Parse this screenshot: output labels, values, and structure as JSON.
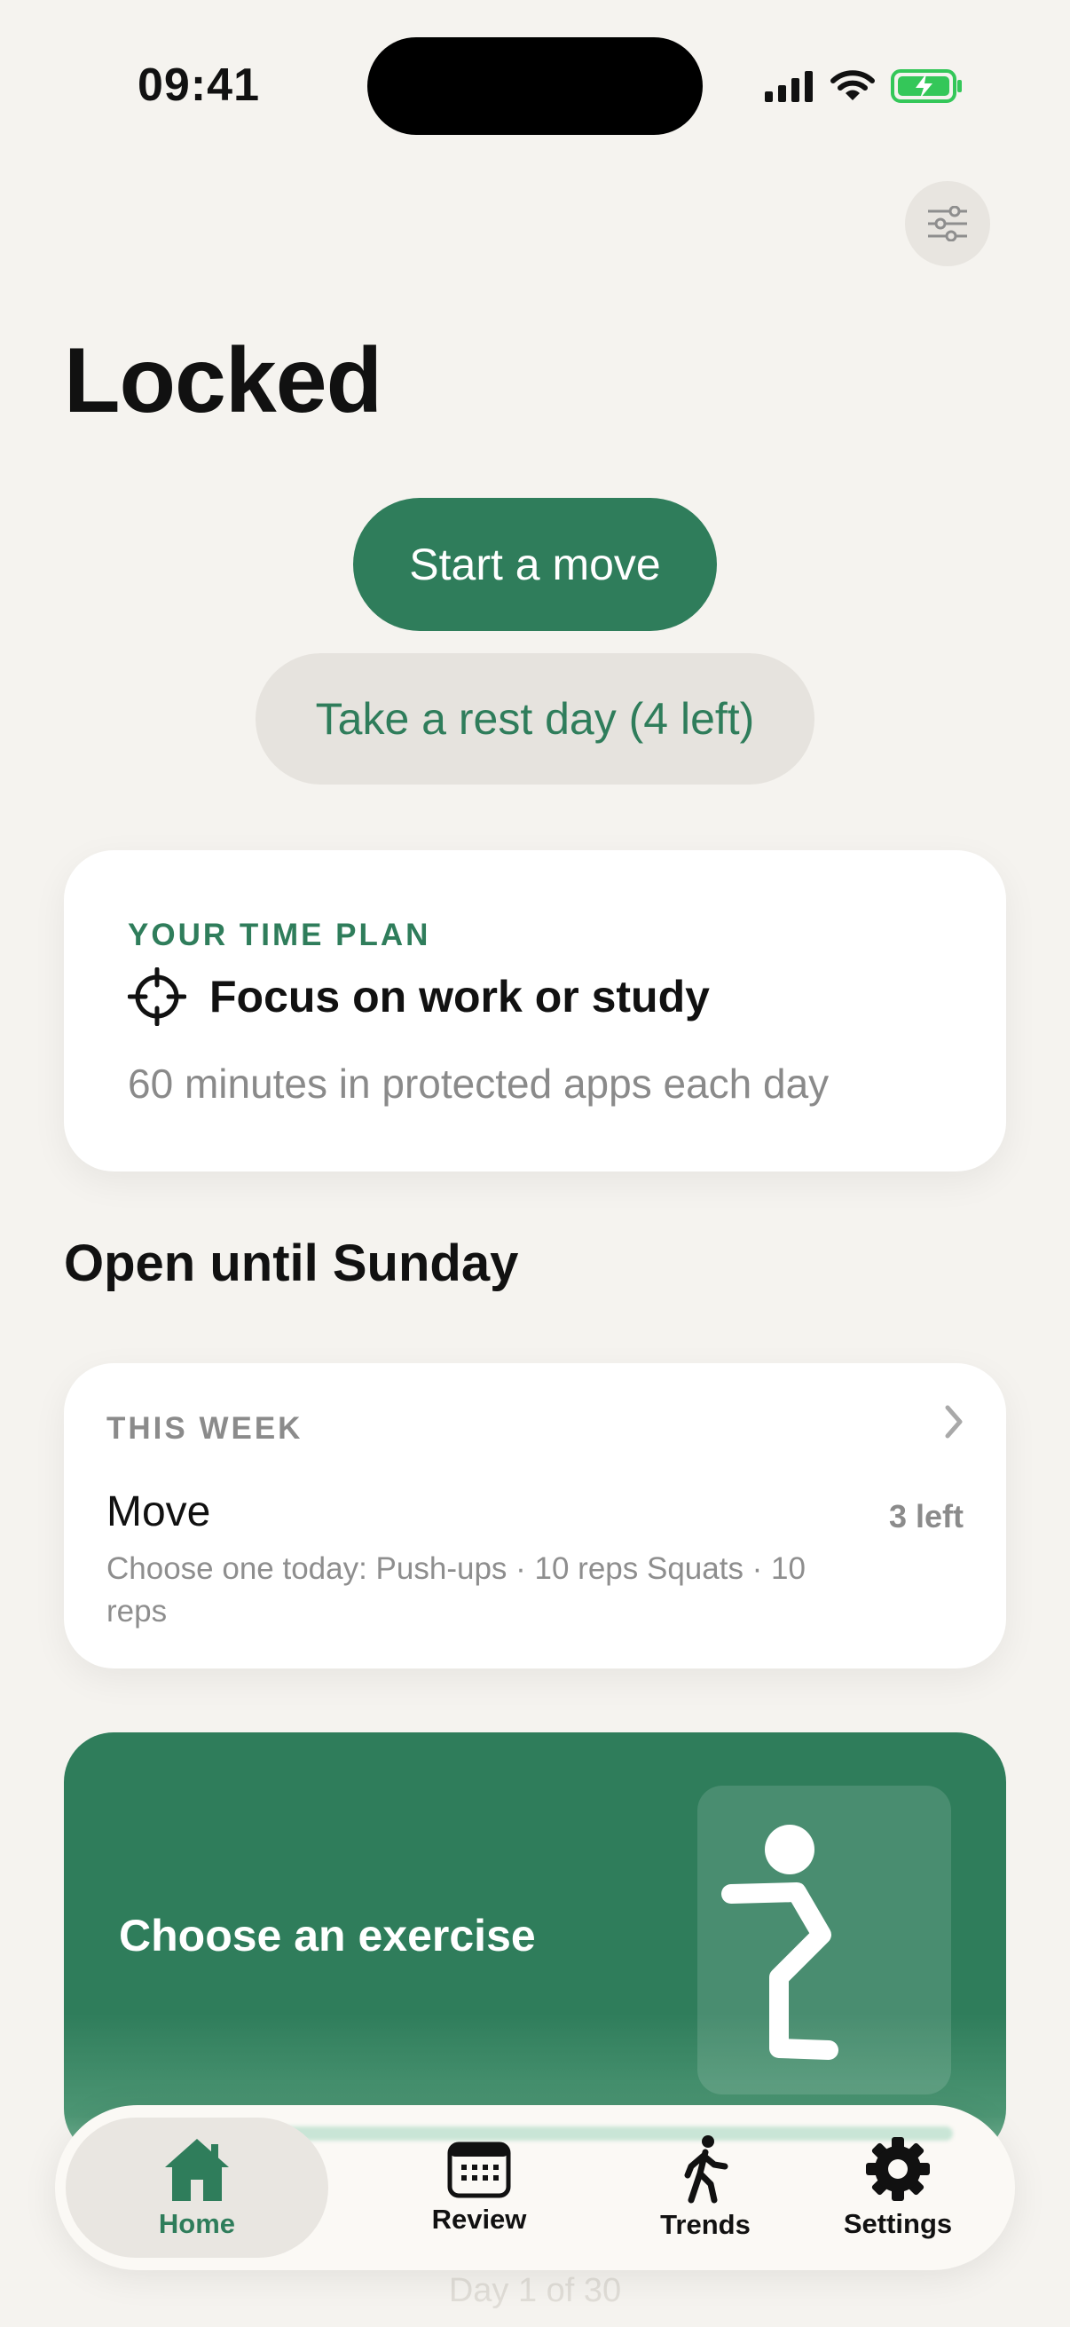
{
  "status_bar": {
    "time": "09:41"
  },
  "header": {
    "title": "Locked"
  },
  "actions": {
    "primary_label": "Start a move",
    "secondary_label": "Take a rest day (4 left)"
  },
  "plan_card": {
    "label": "YOUR TIME PLAN",
    "title": "Focus on work or study",
    "subtitle": "60 minutes in protected apps each day"
  },
  "section": {
    "title": "Open until Sunday"
  },
  "week_card": {
    "label": "THIS WEEK",
    "move_title": "Move",
    "remaining": "3 left",
    "description": "Choose one today: Push-ups · 10 reps   Squats · 10 reps"
  },
  "exercise_card": {
    "label": "Choose an exercise"
  },
  "behind_text": "Day 1 of 30",
  "tabbar": {
    "tabs": [
      {
        "label": "Home",
        "icon": "house-icon",
        "selected": true
      },
      {
        "label": "Review",
        "icon": "calendar-icon",
        "selected": false
      },
      {
        "label": "Trends",
        "icon": "walking-figure-icon",
        "selected": false
      },
      {
        "label": "Settings",
        "icon": "gear-icon",
        "selected": false
      }
    ]
  },
  "colors": {
    "accent": "#2f7d5b",
    "background": "#f5f3ef",
    "battery": "#34c759"
  }
}
